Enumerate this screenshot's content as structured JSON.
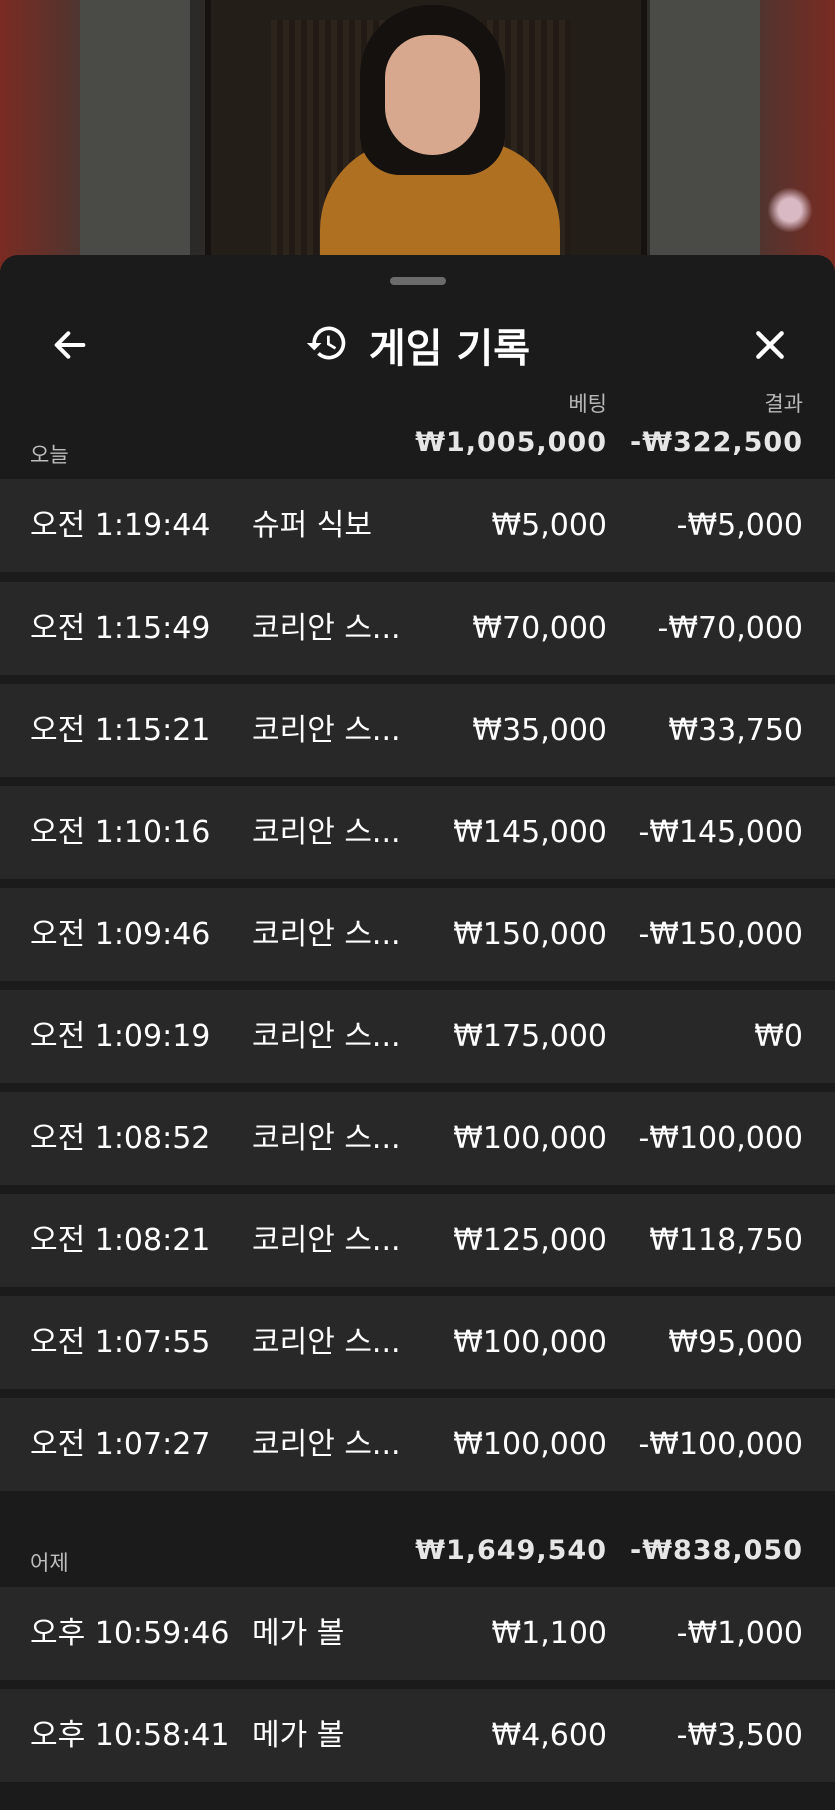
{
  "header": {
    "title": "게임 기록"
  },
  "columns": {
    "bet": "베팅",
    "result": "결과"
  },
  "groups": [
    {
      "label": "오늘",
      "total_bet": "₩1,005,000",
      "total_result": "-₩322,500",
      "rows": [
        {
          "time": "오전 1:19:44",
          "game": "슈퍼 식보",
          "bet": "₩5,000",
          "result": "-₩5,000"
        },
        {
          "time": "오전 1:15:49",
          "game": "코리안 스...",
          "bet": "₩70,000",
          "result": "-₩70,000"
        },
        {
          "time": "오전 1:15:21",
          "game": "코리안 스...",
          "bet": "₩35,000",
          "result": "₩33,750"
        },
        {
          "time": "오전 1:10:16",
          "game": "코리안 스...",
          "bet": "₩145,000",
          "result": "-₩145,000"
        },
        {
          "time": "오전 1:09:46",
          "game": "코리안 스...",
          "bet": "₩150,000",
          "result": "-₩150,000"
        },
        {
          "time": "오전 1:09:19",
          "game": "코리안 스...",
          "bet": "₩175,000",
          "result": "₩0"
        },
        {
          "time": "오전 1:08:52",
          "game": "코리안 스...",
          "bet": "₩100,000",
          "result": "-₩100,000"
        },
        {
          "time": "오전 1:08:21",
          "game": "코리안 스...",
          "bet": "₩125,000",
          "result": "₩118,750"
        },
        {
          "time": "오전 1:07:55",
          "game": "코리안 스...",
          "bet": "₩100,000",
          "result": "₩95,000"
        },
        {
          "time": "오전 1:07:27",
          "game": "코리안 스...",
          "bet": "₩100,000",
          "result": "-₩100,000"
        }
      ]
    },
    {
      "label": "어제",
      "total_bet": "₩1,649,540",
      "total_result": "-₩838,050",
      "rows": [
        {
          "time": "오후 10:59:46",
          "game": "메가 볼",
          "bet": "₩1,100",
          "result": "-₩1,000"
        },
        {
          "time": "오후 10:58:41",
          "game": "메가 볼",
          "bet": "₩4,600",
          "result": "-₩3,500"
        }
      ]
    }
  ],
  "icons": {
    "back": "arrow-left-icon",
    "history": "history-icon",
    "close": "close-icon"
  }
}
